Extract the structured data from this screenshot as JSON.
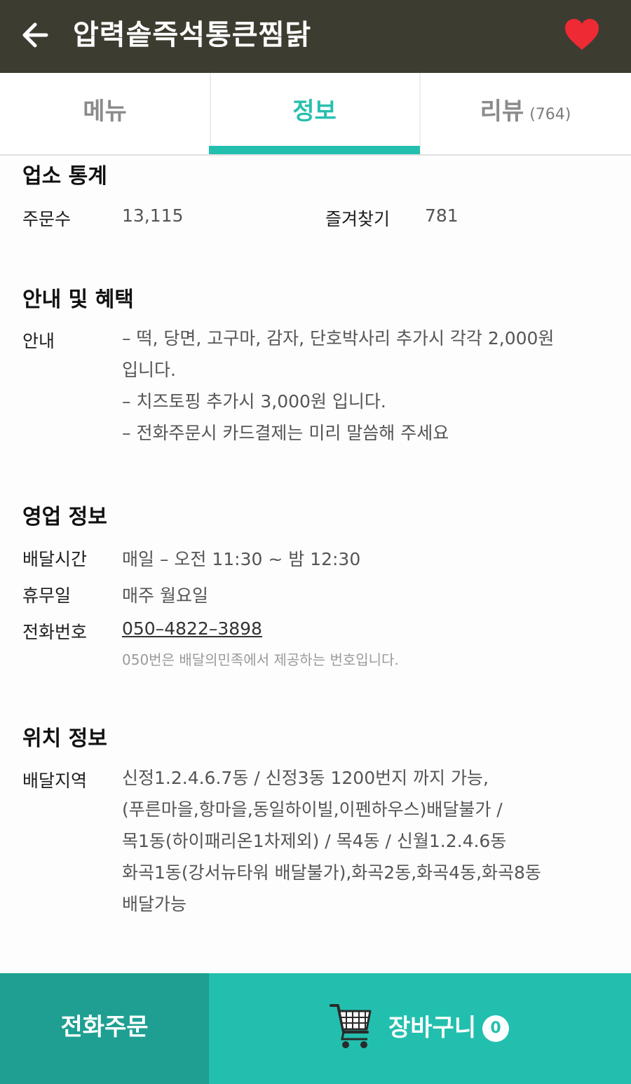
{
  "appbar": {
    "title": "압력솥즉석통큰찜닭",
    "back_icon": "arrow-left-icon",
    "favorite_icon": "heart-icon",
    "favorite_color": "#ee2a34"
  },
  "tabs": [
    {
      "label": "메뉴"
    },
    {
      "label": "정보",
      "active": true
    },
    {
      "label": "리뷰",
      "count": "(764)"
    }
  ],
  "accent_color": "#23bfae",
  "stats": {
    "title": "업소 통계",
    "orders_label": "주문수",
    "orders_value": "13,115",
    "favorites_label": "즐겨찾기",
    "favorites_value": "781"
  },
  "notice": {
    "title": "안내 및 혜택",
    "label": "안내",
    "lines": [
      "– 떡, 당면, 고구마, 감자, 단호박사리 추가시 각각 2,000원",
      "입니다.",
      "– 치즈토핑 추가시 3,000원 입니다.",
      "– 전화주문시 카드결제는 미리 말씀해 주세요"
    ]
  },
  "business": {
    "title": "영업 정보",
    "hours_label": "배달시간",
    "hours_value": "매일 – 오전 11:30 ~ 밤 12:30",
    "holiday_label": "휴무일",
    "holiday_value": "매주 월요일",
    "phone_label": "전화번호",
    "phone_value": "050–4822–3898",
    "phone_note": "050번은 배달의민족에서 제공하는 번호입니다."
  },
  "location": {
    "title": "위치 정보",
    "area_label": "배달지역",
    "area_lines": [
      "신정1.2.4.6.7동 / 신정3동 1200번지 까지 가능,",
      "(푸른마을,항마을,동일하이빌,이펜하우스)배달불가 /",
      "목1동(하이패리온1차제외)  / 목4동 / 신월1.2.4.6동",
      "화곡1동(강서뉴타워 배달불가),화곡2동,화곡4동,화곡8동",
      "배달가능"
    ]
  },
  "bottom": {
    "call_label": "전화주문",
    "cart_label": "장바구니",
    "cart_count": "0",
    "cart_icon": "shopping-cart-icon"
  }
}
